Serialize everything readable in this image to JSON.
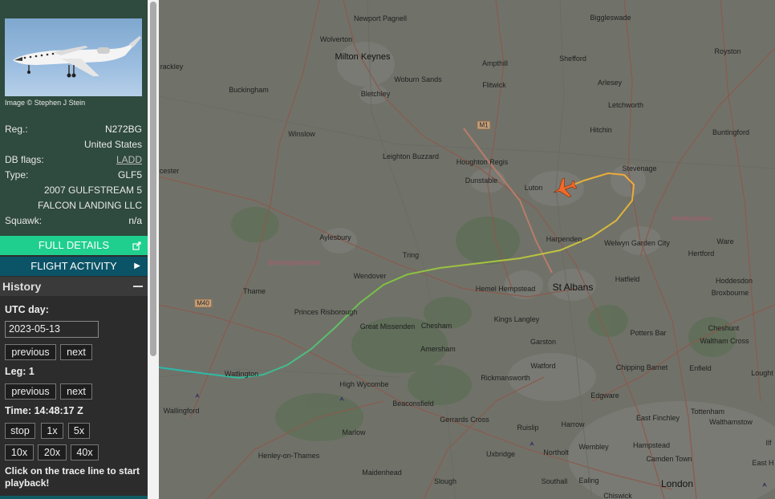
{
  "sidebar": {
    "photo_credit": "Image © Stephen J Stein",
    "reg_label": "Reg.:",
    "reg_value": "N272BG",
    "country": "United States",
    "dbflags_label": "DB flags:",
    "dbflags_value": "LADD",
    "type_label": "Type:",
    "type_value": "GLF5",
    "model": "2007 GULFSTREAM 5",
    "operator": "FALCON LANDING LLC",
    "squawk_label": "Squawk:",
    "squawk_value": "n/a",
    "full_details": "FULL DETAILS",
    "flight_activity": "FLIGHT ACTIVITY",
    "history_title": "History",
    "utc_day_label": "UTC day:",
    "utc_day_value": "2023-05-13",
    "previous": "previous",
    "next": "next",
    "leg_label": "Leg: 1",
    "time_label": "Time: 14:48:17 Z",
    "stop": "stop",
    "speed_1x": "1x",
    "speed_5x": "5x",
    "speed_10x": "10x",
    "speed_20x": "20x",
    "speed_40x": "40x",
    "hint": "Click on the trace line to start playback!"
  },
  "map": {
    "places": {
      "newport_pagnell": "Newport Pagnell",
      "wolverton": "Wolverton",
      "milton_keynes": "Milton Keynes",
      "woburn_sands": "Woburn Sands",
      "buckingham": "Buckingham",
      "bletchley": "Bletchley",
      "ampthill": "Ampthill",
      "flitwick": "Flitwick",
      "shefford": "Shefford",
      "biggleswade": "Biggleswade",
      "royston": "Royston",
      "arlesey": "Arlesey",
      "letchworth": "Letchworth",
      "hitchin": "Hitchin",
      "buntingford": "Buntingford",
      "winslow": "Winslow",
      "leighton_buzzard": "Leighton Buzzard",
      "houghton_regis": "Houghton Regis",
      "dunstable": "Dunstable",
      "luton": "Luton",
      "stevenage": "Stevenage",
      "hertfordshire": "Hertfordshire",
      "harpenden": "Harpenden",
      "welwyn_garden_city": "Welwyn Garden City",
      "ware": "Ware",
      "hertford": "Hertford",
      "aylesbury": "Aylesbury",
      "tring": "Tring",
      "buckinghamshire": "Buckinghamshire",
      "wendover": "Wendover",
      "hemel_hempstead": "Hemel Hempstead",
      "st_albans": "St Albans",
      "hatfield": "Hatfield",
      "hoddesdon": "Hoddesdon",
      "broxbourne": "Broxbourne",
      "thame": "Thame",
      "princes_risborough": "Princes Risborough",
      "great_missenden": "Great Missenden",
      "chesham": "Chesham",
      "kings_langley": "Kings Langley",
      "potters_bar": "Potters Bar",
      "cheshunt": "Cheshunt",
      "waltham_cross": "Waltham Cross",
      "amersham": "Amersham",
      "garston": "Garston",
      "watford": "Watford",
      "chipping_barnet": "Chipping Barnet",
      "enfield": "Enfield",
      "watlington": "Watlington",
      "rickmansworth": "Rickmansworth",
      "high_wycombe": "High Wycombe",
      "edgware": "Edgware",
      "wallingford": "Wallingford",
      "beaconsfield": "Beaconsfield",
      "gerrards_cross": "Gerrards Cross",
      "ruislip": "Ruislip",
      "harrow": "Harrow",
      "east_finchley": "East Finchley",
      "tottenham": "Tottenham",
      "walthamstow": "Walthamstow",
      "marlow": "Marlow",
      "northolt": "Northolt",
      "wembley": "Wembley",
      "hampstead": "Hampstead",
      "uxbridge": "Uxbridge",
      "henley_on_thames": "Henley-on-Thames",
      "camden_town": "Camden Town",
      "maidenhead": "Maidenhead",
      "slough": "Slough",
      "southall": "Southall",
      "ealing": "Ealing",
      "chiswick": "Chiswick",
      "london": "London",
      "loughton": "Lought",
      "east_ham": "East H",
      "brackley": "rackley",
      "bicester": "cester",
      "ilford": "Ilf"
    },
    "roads": {
      "m1": "M1",
      "m40": "M40"
    },
    "colors": {
      "track_start": "#23b9b4",
      "track_mid": "#7bc142",
      "track_end": "#f0a93a",
      "aircraft": "#f26a2a"
    }
  }
}
